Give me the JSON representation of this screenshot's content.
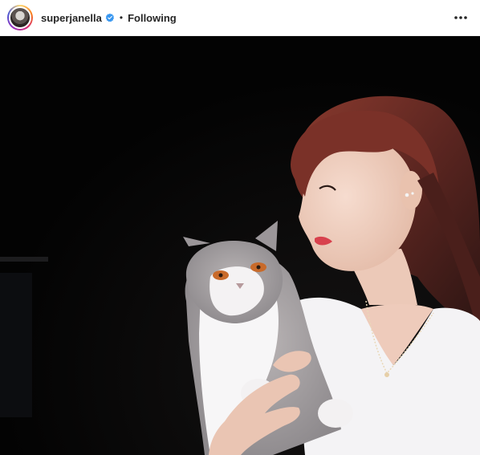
{
  "header": {
    "username": "superjanella",
    "separator": "•",
    "follow_status": "Following",
    "verified_icon": "verified-badge-icon",
    "more_icon": "more-options-icon",
    "verified_color": "#3897f0"
  },
  "post": {
    "image_subject": "woman-holding-gray-white-persian-cat"
  }
}
